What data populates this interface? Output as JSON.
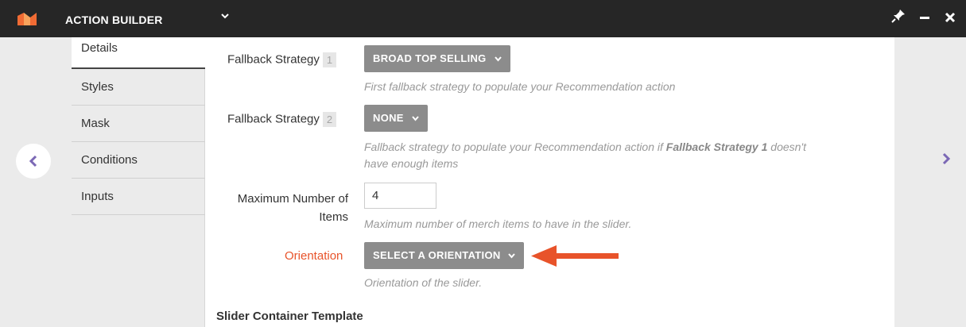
{
  "header": {
    "app_title": "ACTION BUILDER",
    "window_buttons": {
      "pin": "pin-icon",
      "minimize": "minimize-icon",
      "close": "close-icon"
    }
  },
  "sidebar": {
    "items": [
      {
        "label": "Details",
        "active": true
      },
      {
        "label": "Styles",
        "active": false
      },
      {
        "label": "Mask",
        "active": false
      },
      {
        "label": "Conditions",
        "active": false
      },
      {
        "label": "Inputs",
        "active": false
      }
    ]
  },
  "form": {
    "fallback1": {
      "label": "Fallback Strategy",
      "badge": "1",
      "value": "BROAD TOP SELLING",
      "help": "First fallback strategy to populate your Recommendation action"
    },
    "fallback2": {
      "label": "Fallback Strategy",
      "badge": "2",
      "value": "NONE",
      "help_part1": "Fallback strategy to populate your Recommendation action if ",
      "help_bold": "Fallback Strategy 1",
      "help_part2": " doesn't",
      "help_line2": "have enough items"
    },
    "max_items": {
      "label_line1": "Maximum Number of",
      "label_line2": "Items",
      "value": "4",
      "help": "Maximum number of merch items to have in the slider."
    },
    "orientation": {
      "label": "Orientation",
      "value": "SELECT A ORIENTATION",
      "help": "Orientation of the slider."
    },
    "slider_container": {
      "label": "Slider Container Template"
    }
  },
  "colors": {
    "topbar": "#262626",
    "accent_orange": "#e8532a",
    "dropdown_bg": "#8c8c8c",
    "nav_purple": "#7b68b5",
    "logo_purple": "#5c4a9e",
    "logo_orange": "#f06b34"
  }
}
